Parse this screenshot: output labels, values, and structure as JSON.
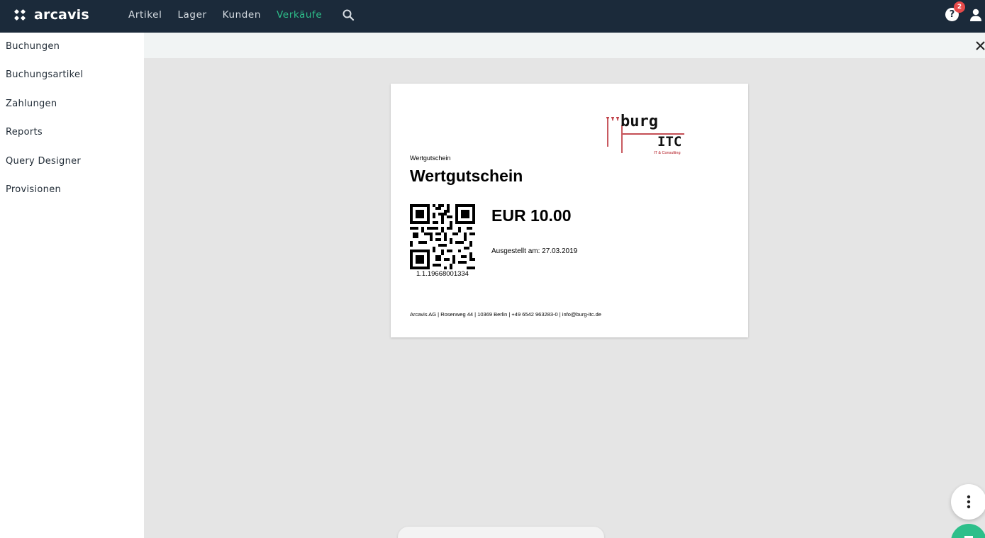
{
  "app": {
    "name": "arcavis"
  },
  "topnav": {
    "items": [
      {
        "label": "Artikel",
        "active": false
      },
      {
        "label": "Lager",
        "active": false
      },
      {
        "label": "Kunden",
        "active": false
      },
      {
        "label": "Verkäufe",
        "active": true
      }
    ],
    "help_badge_count": "2",
    "accent_color": "#2dbf8a",
    "bar_color": "#1b2a3a"
  },
  "sidebar": {
    "items": [
      {
        "label": "Buchungen"
      },
      {
        "label": "Buchungsartikel"
      },
      {
        "label": "Zahlungen"
      },
      {
        "label": "Reports"
      },
      {
        "label": "Query Designer"
      },
      {
        "label": "Provisionen"
      }
    ]
  },
  "icons": {
    "logo": "arcavis-logo-icon",
    "search": "search-icon",
    "help": "help-icon",
    "user": "user-icon",
    "close": "close-icon",
    "more": "more-vertical-icon"
  },
  "document": {
    "brand_logo_text": "burg ITC",
    "brand_logo_subtext": "IT & Consulting",
    "small_title": "Wertgutschein",
    "title": "Wertgutschein",
    "qr_code_value": "1.1.19668001334",
    "amount": "EUR 10.00",
    "issued": "Ausgestellt am: 27.03.2019",
    "footer": "Arcavis AG | Rosenweg 44 | 10369 Berlin | +49 6542 963283-0 | info@burg-itc.de"
  }
}
